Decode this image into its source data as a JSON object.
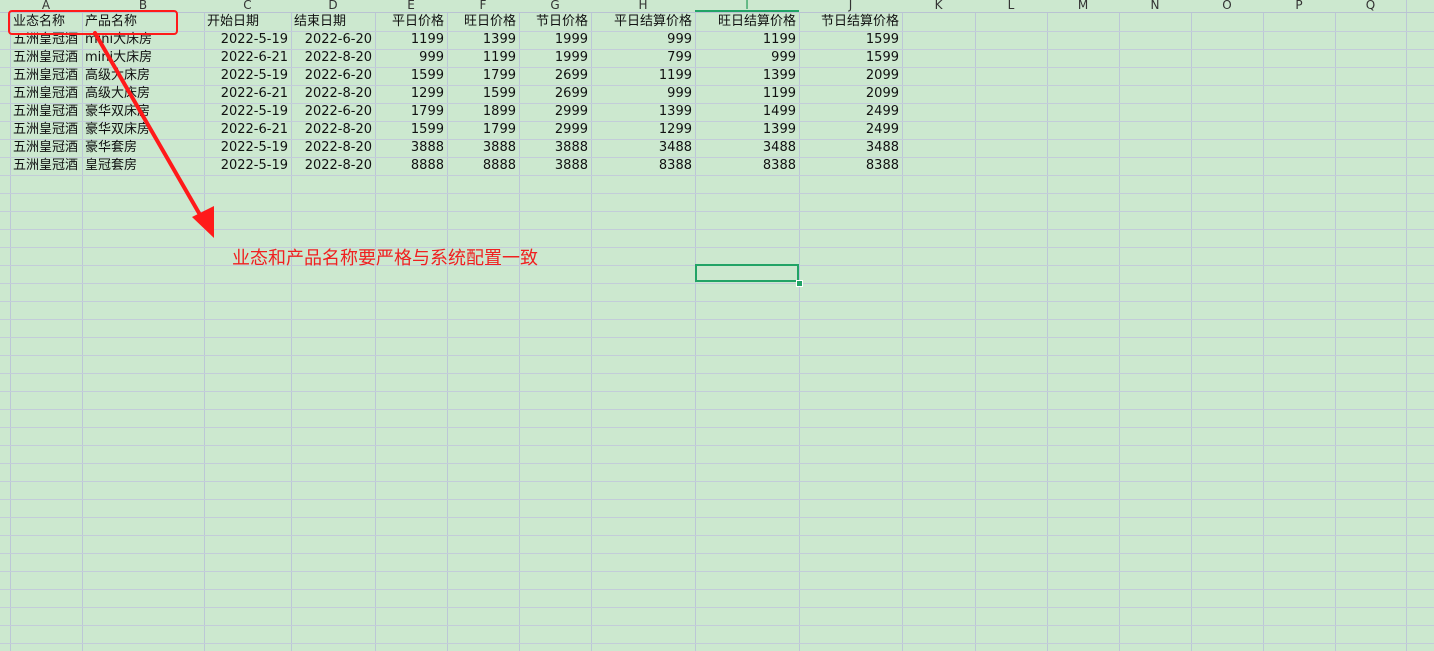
{
  "column_headers": [
    "A",
    "B",
    "C",
    "D",
    "E",
    "F",
    "G",
    "H",
    "I",
    "J",
    "K",
    "L",
    "M",
    "N",
    "O",
    "P",
    "Q"
  ],
  "selected_column": "I",
  "header_row": [
    "业态名称",
    "产品名称",
    "开始日期",
    "结束日期",
    "平日价格",
    "旺日价格",
    "节日价格",
    "平日结算价格",
    "旺日结算价格",
    "节日结算价格"
  ],
  "rows": [
    [
      "五洲皇冠酒",
      "mini大床房",
      "2022-5-19",
      "2022-6-20",
      "1199",
      "1399",
      "1999",
      "999",
      "1199",
      "1599"
    ],
    [
      "五洲皇冠酒",
      "mini大床房",
      "2022-6-21",
      "2022-8-20",
      "999",
      "1199",
      "1999",
      "799",
      "999",
      "1599"
    ],
    [
      "五洲皇冠酒",
      "高级大床房",
      "2022-5-19",
      "2022-6-20",
      "1599",
      "1799",
      "2699",
      "1199",
      "1399",
      "2099"
    ],
    [
      "五洲皇冠酒",
      "高级大床房",
      "2022-6-21",
      "2022-8-20",
      "1299",
      "1599",
      "2699",
      "999",
      "1199",
      "2099"
    ],
    [
      "五洲皇冠酒",
      "豪华双床房",
      "2022-5-19",
      "2022-6-20",
      "1799",
      "1899",
      "2999",
      "1399",
      "1499",
      "2499"
    ],
    [
      "五洲皇冠酒",
      "豪华双床房",
      "2022-6-21",
      "2022-8-20",
      "1599",
      "1799",
      "2999",
      "1299",
      "1399",
      "2499"
    ],
    [
      "五洲皇冠酒",
      "豪华套房",
      "2022-5-19",
      "2022-8-20",
      "3888",
      "3888",
      "3888",
      "3488",
      "3488",
      "3488"
    ],
    [
      "五洲皇冠酒",
      "皇冠套房",
      "2022-5-19",
      "2022-8-20",
      "8888",
      "8888",
      "3888",
      "8388",
      "8388",
      "8388"
    ]
  ],
  "annotation": {
    "note_text": "业态和产品名称要严格与系统配置一致",
    "color": "#f02020"
  },
  "colors": {
    "sheet_background": "#cce8cf",
    "selection": "#21a366",
    "gridline": "#c3ccd9"
  }
}
